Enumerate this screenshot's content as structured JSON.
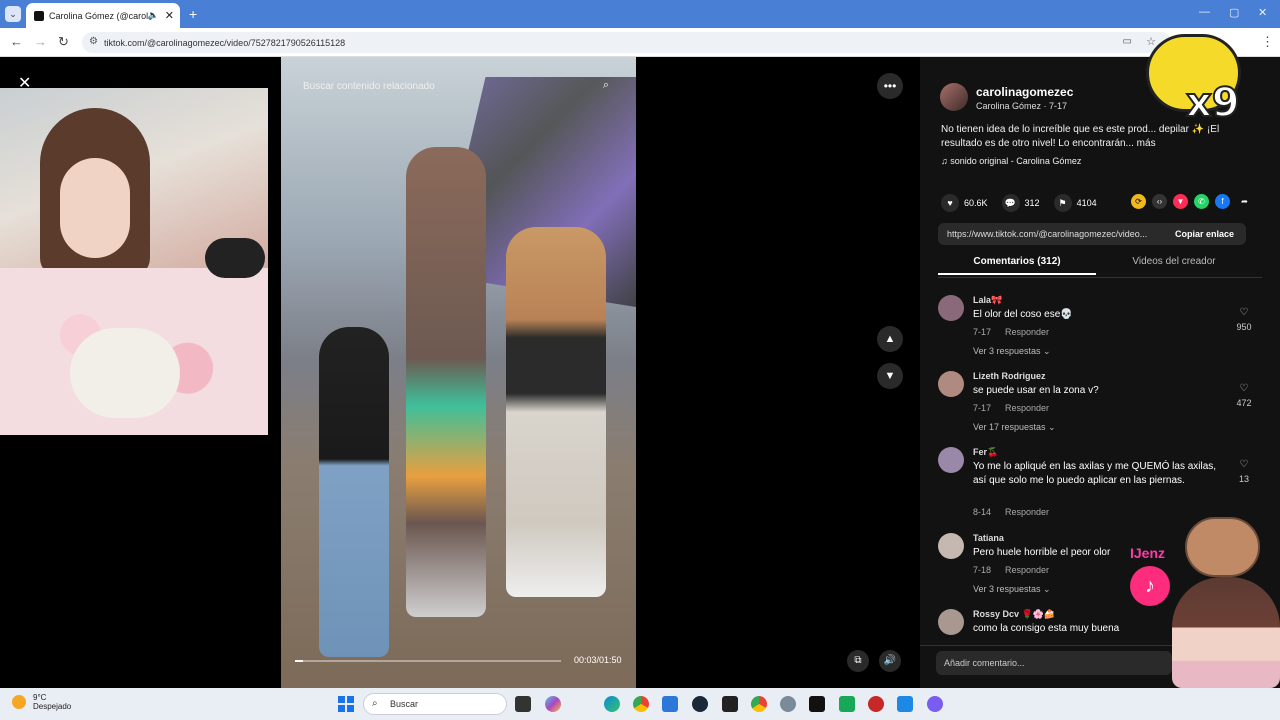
{
  "browser": {
    "tab_title": "Carolina Gómez (@carolina",
    "tab_audio_icon": "speaker-icon",
    "tab_close": "✕",
    "new_tab": "+",
    "url": "tiktok.com/@carolinagomezec/video/7527821790526115128"
  },
  "video": {
    "search_placeholder": "Buscar contenido relacionado",
    "timecode": "00:03/01:50",
    "progress": 0.03
  },
  "post": {
    "username": "carolinagomezec",
    "subtitle": "Carolina Gómez · 7-17",
    "description": "No tienen idea de lo increíble que es este prod... depilar ✨ ¡El resultado es de otro nivel! Lo encontrarán... más",
    "sound": "sonido original - Carolina Gómez",
    "likes": "60.6K",
    "comments": "312",
    "saves": "4104",
    "link": "https://www.tiktok.com/@carolinagomezec/video...",
    "copy_link": "Copiar enlace",
    "tab_comments": "Comentarios (312)",
    "tab_creator_videos": "Videos del creador",
    "add_comment_placeholder": "Añadir comentario..."
  },
  "comments": [
    {
      "user": "Lala🎀",
      "text": "El olor del coso ese💀",
      "date": "7-17",
      "reply": "Responder",
      "likes": "950",
      "more": "Ver 3 respuestas ⌄"
    },
    {
      "user": "Lizeth Rodriguez",
      "text": "se puede usar en la zona v?",
      "date": "7-17",
      "reply": "Responder",
      "likes": "472",
      "more": "Ver 17 respuestas ⌄"
    },
    {
      "user": "Fer🍒",
      "text": "Yo me lo apliqué en las axilas y me QUEMÓ las axilas, así que solo me lo puedo aplicar en las piernas.",
      "date": "8-14",
      "reply": "Responder",
      "likes": "13",
      "more": ""
    },
    {
      "user": "Tatiana",
      "text": "Pero huele horrible el peor olor",
      "date": "7-18",
      "reply": "Responder",
      "likes": "",
      "more": "Ver 3 respuestas ⌄"
    },
    {
      "user": "Rossy Dcv 🌹🌸🍰",
      "text": "como la consigo esta muy buena",
      "date": "",
      "reply": "",
      "likes": "",
      "more": ""
    }
  ],
  "overlay": {
    "x9": "x9",
    "streamer": "IJenz"
  },
  "taskbar": {
    "temp": "9°C",
    "condition": "Despejado",
    "search": "Buscar"
  }
}
